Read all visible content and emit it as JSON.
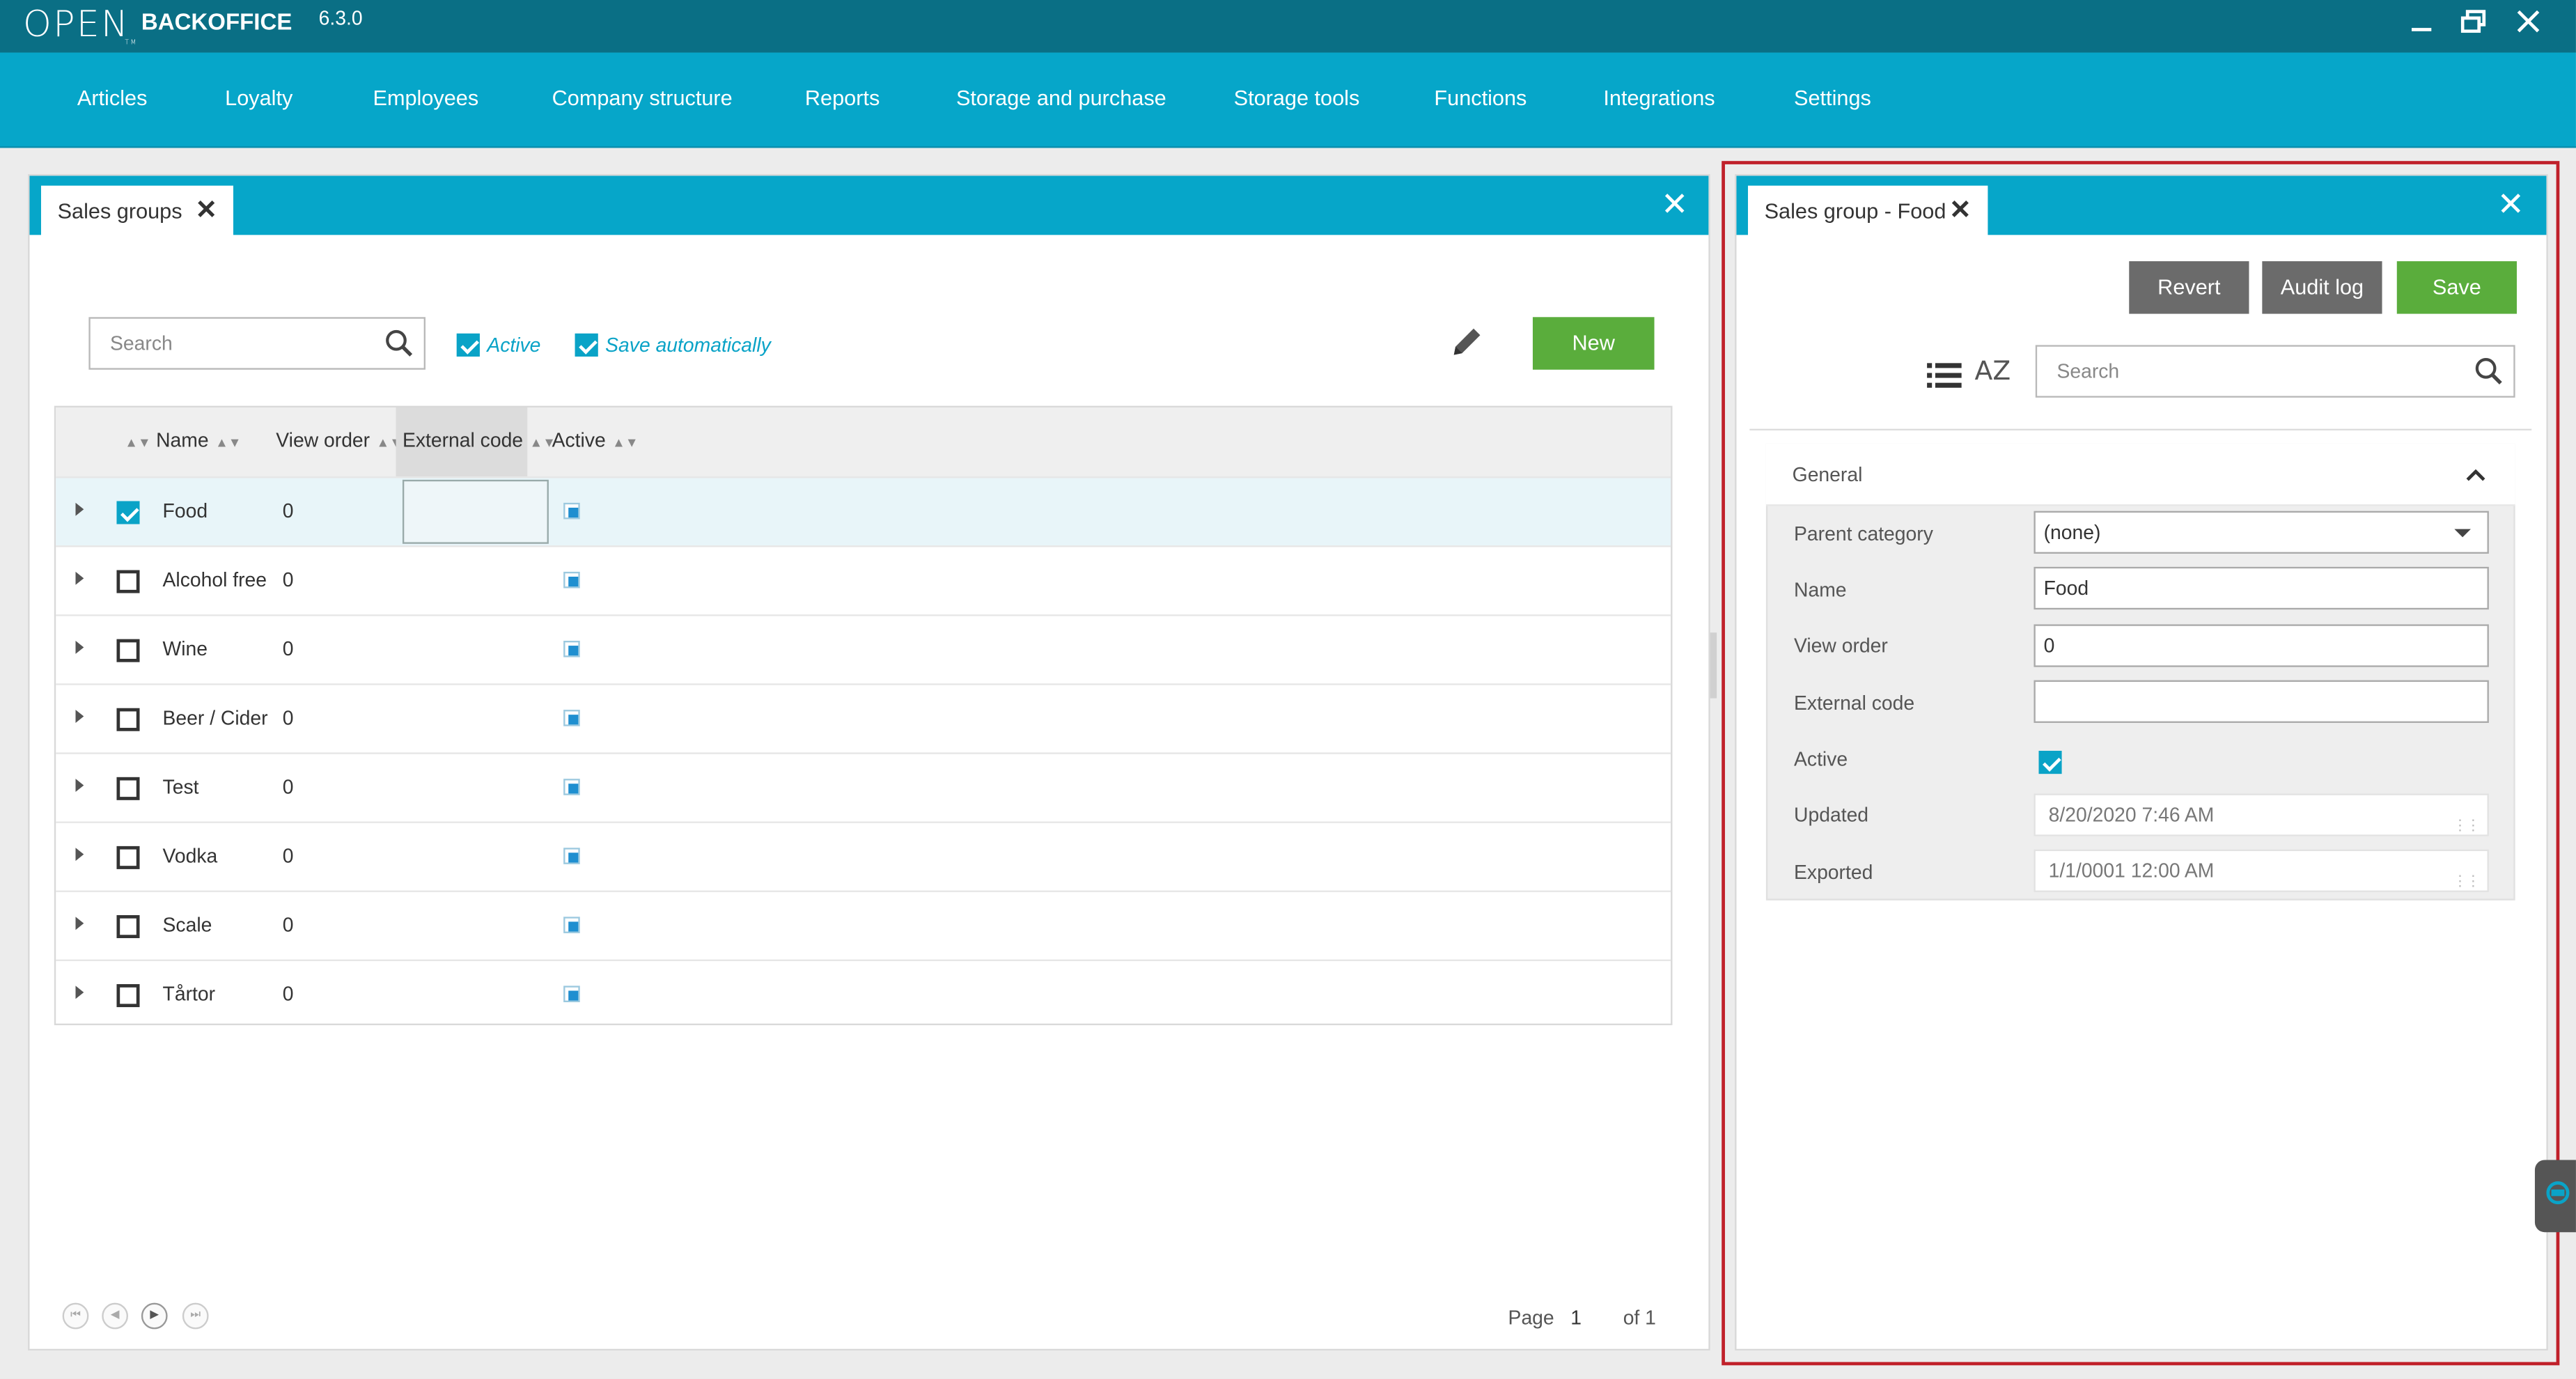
{
  "titlebar": {
    "logo": "OPEN",
    "logo_tm": "TM",
    "app_name": "BACKOFFICE",
    "version": "6.3.0"
  },
  "menu": {
    "items": [
      "Articles",
      "Loyalty",
      "Employees",
      "Company structure",
      "Reports",
      "Storage and purchase",
      "Storage tools",
      "Functions",
      "Integrations",
      "Settings"
    ]
  },
  "left_panel": {
    "tab_label": "Sales groups",
    "search_placeholder": "Search",
    "active_label": "Active",
    "save_auto_label": "Save automatically",
    "new_label": "New",
    "columns": [
      "Name",
      "View order",
      "External code",
      "Active"
    ],
    "rows": [
      {
        "name": "Food",
        "view_order": "0",
        "checked": true,
        "selected": true
      },
      {
        "name": "Alcohol free",
        "view_order": "0",
        "checked": false,
        "selected": false
      },
      {
        "name": "Wine",
        "view_order": "0",
        "checked": false,
        "selected": false
      },
      {
        "name": "Beer / Cider",
        "view_order": "0",
        "checked": false,
        "selected": false
      },
      {
        "name": "Test",
        "view_order": "0",
        "checked": false,
        "selected": false
      },
      {
        "name": "Vodka",
        "view_order": "0",
        "checked": false,
        "selected": false
      },
      {
        "name": "Scale",
        "view_order": "0",
        "checked": false,
        "selected": false
      },
      {
        "name": "Tårtor",
        "view_order": "0",
        "checked": false,
        "selected": false
      }
    ],
    "pager": {
      "page_label": "Page",
      "page": "1",
      "of_label": "of 1"
    }
  },
  "right_panel": {
    "tab_label": "Sales group - Food",
    "revert_label": "Revert",
    "audit_label": "Audit log",
    "save_label": "Save",
    "search_placeholder": "Search",
    "sort_icon_text": "AZ",
    "section_title": "General",
    "fields": {
      "parent_category": {
        "label": "Parent category",
        "value": "(none)"
      },
      "name": {
        "label": "Name",
        "value": "Food"
      },
      "view_order": {
        "label": "View order",
        "value": "0"
      },
      "external_code": {
        "label": "External code",
        "value": ""
      },
      "active": {
        "label": "Active",
        "checked": true
      },
      "updated": {
        "label": "Updated",
        "value": "8/20/2020 7:46 AM"
      },
      "exported": {
        "label": "Exported",
        "value": "1/1/0001 12:00 AM"
      }
    }
  },
  "colors": {
    "titlebar": "#0a6f85",
    "menubar": "#06a6c9",
    "accent": "#0aa3c7",
    "green": "#5aad3c",
    "grey_button": "#6b6b6b",
    "highlight_border": "#c0202a"
  }
}
